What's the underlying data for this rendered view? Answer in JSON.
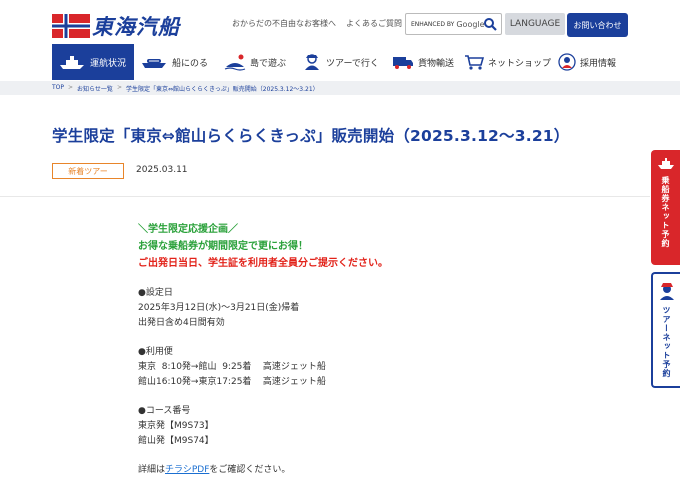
{
  "header": {
    "logo_text": "東海汽船",
    "links": [
      "おからだの不自由なお客様へ",
      "よくあるご質問"
    ],
    "search": {
      "enhanced_by": "ENHANCED BY",
      "google": "Google"
    },
    "language_label": "LANGUAGE",
    "contact_label": "お問い合わせ"
  },
  "nav": {
    "items": [
      {
        "label": "運航状況",
        "icon": "ship-status-icon"
      },
      {
        "label": "船にのる",
        "icon": "boat-icon"
      },
      {
        "label": "島で遊ぶ",
        "icon": "island-icon"
      },
      {
        "label": "ツアーで行く",
        "icon": "tour-person-icon"
      },
      {
        "label": "貨物輸送",
        "icon": "cargo-truck-icon"
      },
      {
        "label": "ネットショップ",
        "icon": "cart-icon"
      },
      {
        "label": "採用情報",
        "icon": "recruit-person-icon"
      }
    ]
  },
  "breadcrumb": {
    "items": [
      "TOP",
      "お知らせ一覧",
      "学生限定「東京⇔館山らくらくきっぷ」販売開始（2025.3.12〜3.21）"
    ]
  },
  "article": {
    "title": "学生限定「東京⇔館山らくらくきっぷ」販売開始（2025.3.12〜3.21）",
    "badge": "新着ツアー",
    "date": "2025.03.11",
    "green_line1": "＼学生限定応援企画／",
    "green_line2": "お得な乗船券が期間限定で更にお得！",
    "red_line": "ご出発日当日、学生証を利用者全員分ご提示ください。",
    "period_heading": "●設定日",
    "period_line1": "2025年3月12日(水)〜3月21日(金)帰着",
    "period_line2": "出発日含め4日間有効",
    "service_heading": "●利用便",
    "service_line1": "東京  8:10発→館山  9:25着    高速ジェット船",
    "service_line2": "館山16:10発→東京17:25着    高速ジェット船",
    "course_heading": "●コース番号",
    "course_line1": "東京発【M9S73】",
    "course_line2": "館山発【M9S74】",
    "detail_prefix": "詳細は",
    "detail_link": "チラシPDF",
    "detail_suffix": "をご確認ください。"
  },
  "side_tabs": {
    "ship": "乗船券ネット予約",
    "tour": "ツアーネット予約"
  },
  "colors": {
    "brand_blue": "#1b3f9b",
    "badge_orange": "#e8852a",
    "green": "#2aa13a",
    "red": "#e2231a"
  }
}
